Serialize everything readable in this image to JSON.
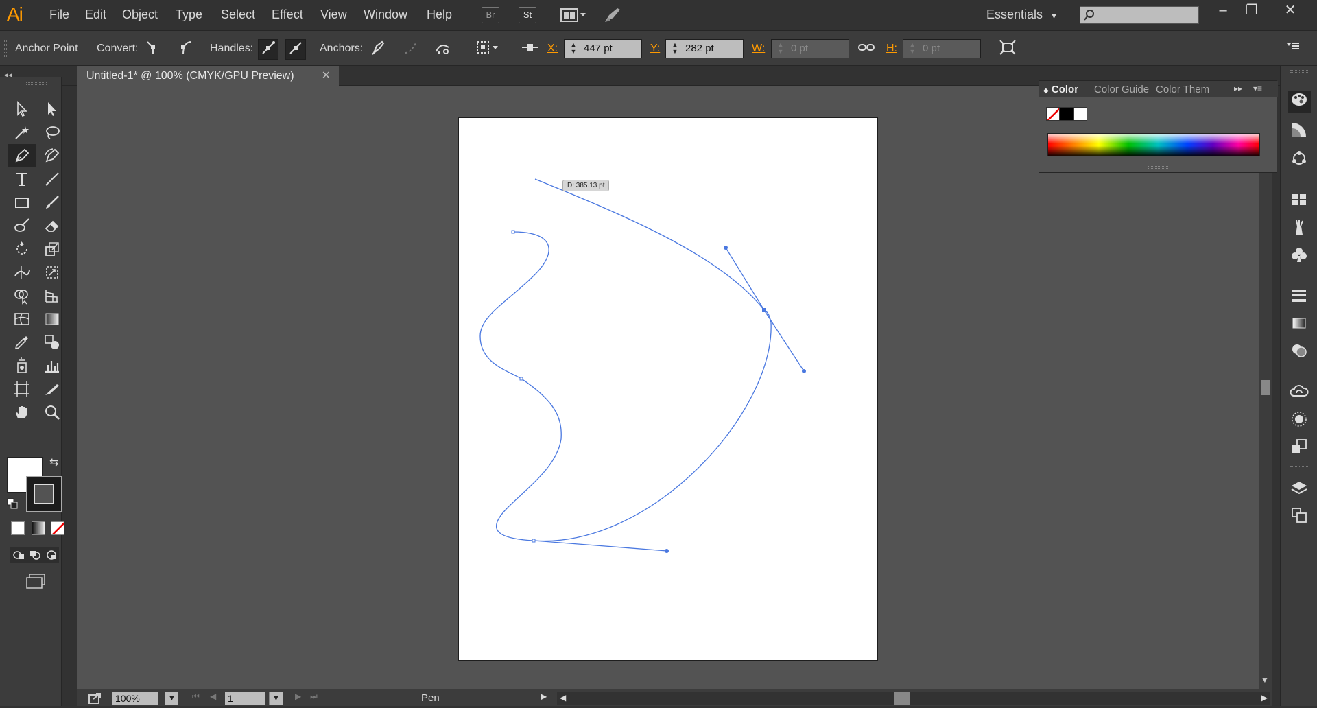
{
  "app": {
    "logo": "Ai"
  },
  "menu": [
    "File",
    "Edit",
    "Object",
    "Type",
    "Select",
    "Effect",
    "View",
    "Window",
    "Help"
  ],
  "appbar": {
    "bridge": "Br",
    "stock": "St",
    "workspace": "Essentials"
  },
  "window_controls": {
    "minimize": "–",
    "restore": "❐",
    "close": "✕"
  },
  "controlbar": {
    "tool_name": "Anchor Point",
    "convert_label": "Convert:",
    "handles_label": "Handles:",
    "anchors_label": "Anchors:",
    "x_label": "X:",
    "x_value": "447 pt",
    "y_label": "Y:",
    "y_value": "282 pt",
    "w_label": "W:",
    "w_value": "0 pt",
    "h_label": "H:",
    "h_value": "0 pt"
  },
  "document": {
    "tab_title": "Untitled-1* @ 100% (CMYK/GPU Preview)",
    "close": "✕"
  },
  "canvas": {
    "distance_tooltip": "D: 385.13 pt"
  },
  "statusbar": {
    "zoom": "100%",
    "artboard": "1",
    "status": "Pen"
  },
  "color_panel": {
    "tabs": [
      "Color",
      "Color Guide",
      "Color Them"
    ]
  },
  "colors": {
    "accent": "#ff9a00",
    "path_stroke": "#4a78e0",
    "canvas_bg": "#535353",
    "ui_bg": "#323232"
  }
}
